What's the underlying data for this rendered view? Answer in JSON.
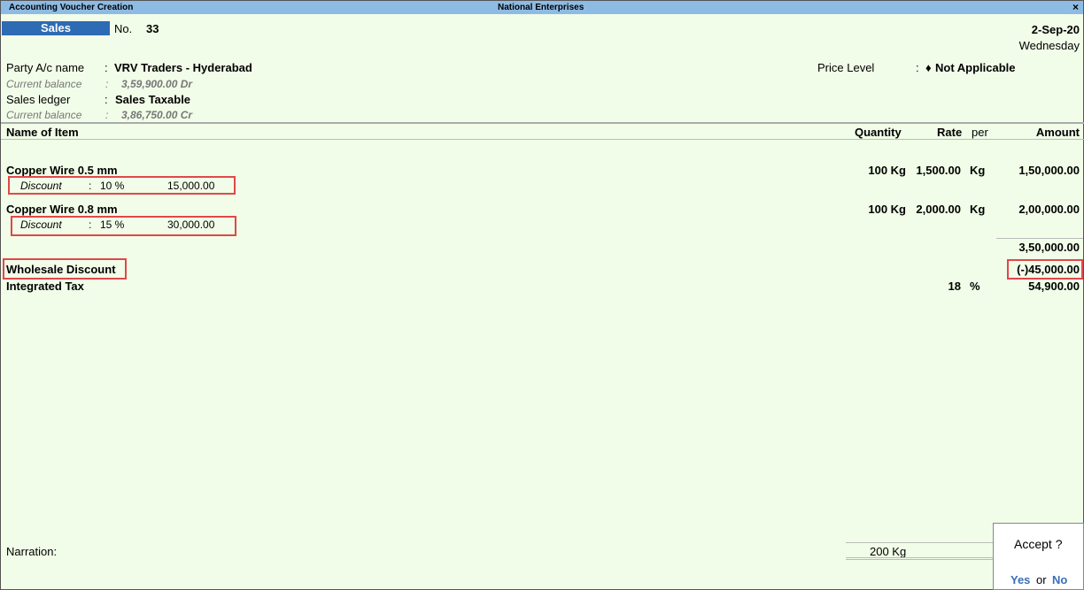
{
  "window": {
    "title": "Accounting Voucher Creation",
    "company": "National Enterprises",
    "close": "×"
  },
  "voucher": {
    "type": "Sales",
    "no_label": "No.",
    "no": "33",
    "date": "2-Sep-20",
    "day": "Wednesday"
  },
  "party": {
    "label": "Party A/c name",
    "value": "VRV Traders - Hyderabad",
    "bal_label": "Current balance",
    "bal": "3,59,900.00 Dr"
  },
  "ledger": {
    "label": "Sales ledger",
    "value": "Sales Taxable",
    "bal_label": "Current balance",
    "bal": "3,86,750.00 Cr"
  },
  "price_level": {
    "label": "Price Level",
    "value": "Not Applicable"
  },
  "columns": {
    "name": "Name of Item",
    "qty": "Quantity",
    "rate": "Rate",
    "per": "per",
    "amount": "Amount"
  },
  "items": [
    {
      "name": "Copper Wire 0.5 mm",
      "qty": "100 Kg",
      "rate": "1,500.00",
      "per": "Kg",
      "amount": "1,50,000.00",
      "disc_label": "Discount",
      "disc_pct": "10 %",
      "disc_amt": "15,000.00"
    },
    {
      "name": "Copper Wire 0.8 mm",
      "qty": "100 Kg",
      "rate": "2,000.00",
      "per": "Kg",
      "amount": "2,00,000.00",
      "disc_label": "Discount",
      "disc_pct": "15 %",
      "disc_amt": "30,000.00"
    }
  ],
  "subtotal": "3,50,000.00",
  "ledgers": [
    {
      "name": "Wholesale Discount",
      "rate": "",
      "per": "",
      "amount": "(-)45,000.00"
    },
    {
      "name": "Integrated Tax",
      "rate": "18",
      "per": "%",
      "amount": "54,900.00"
    }
  ],
  "narration_label": "Narration:",
  "total_qty": "200 Kg",
  "accept": {
    "prompt": "Accept ?",
    "yes": "Yes",
    "or": "or",
    "no": "No"
  }
}
